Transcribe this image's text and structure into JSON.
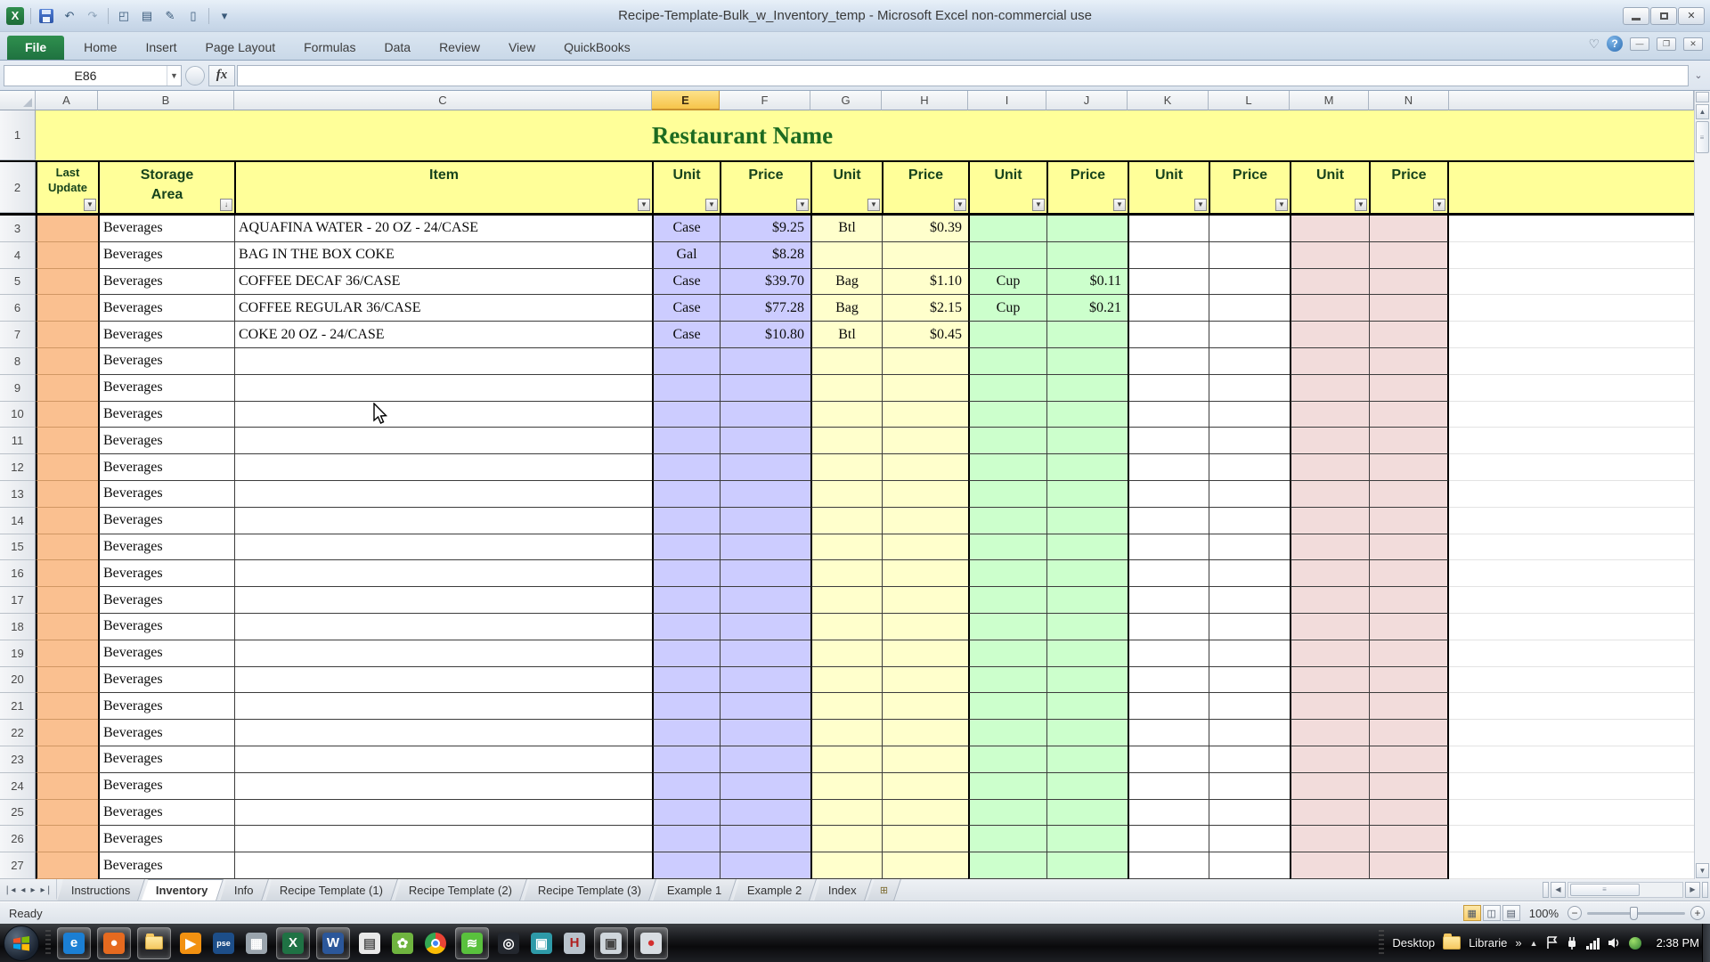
{
  "window": {
    "title": "Recipe-Template-Bulk_w_Inventory_temp  -  Microsoft Excel non-commercial use"
  },
  "qat": {
    "icons": [
      {
        "name": "excel-logo-icon",
        "glyph": "X"
      },
      {
        "name": "save-icon",
        "glyph": ""
      },
      {
        "name": "undo-icon",
        "glyph": "↶"
      },
      {
        "name": "redo-icon",
        "glyph": "↷"
      },
      {
        "name": "print-preview-icon",
        "glyph": "◰"
      },
      {
        "name": "print-icon",
        "glyph": "▤"
      },
      {
        "name": "edit-icon",
        "glyph": "✎"
      },
      {
        "name": "new-document-icon",
        "glyph": "▯"
      },
      {
        "name": "customize-quick-access-toolbar-icon",
        "glyph": "▾"
      }
    ]
  },
  "ribbon": {
    "tabs": [
      "File",
      "Home",
      "Insert",
      "Page Layout",
      "Formulas",
      "Data",
      "Review",
      "View",
      "QuickBooks"
    ],
    "active_tab": "File",
    "right_icons": [
      {
        "name": "favorite-icon",
        "glyph": "♡"
      },
      {
        "name": "help-icon",
        "glyph": "?"
      },
      {
        "name": "minimize-window-icon",
        "glyph": "—"
      },
      {
        "name": "restore-window-icon",
        "glyph": "❐"
      },
      {
        "name": "close-window-icon",
        "glyph": "✕"
      }
    ]
  },
  "formula_bar": {
    "name_box": "E86",
    "fx_label": "fx",
    "formula_value": ""
  },
  "grid": {
    "column_letters": [
      "A",
      "B",
      "C",
      "E",
      "F",
      "G",
      "H",
      "I",
      "J",
      "K",
      "L",
      "M",
      "N"
    ],
    "selected_column": "E",
    "row1_num": "1",
    "row2_num": "2",
    "title": "Restaurant Name",
    "header_cells": [
      {
        "col": "A",
        "lines": [
          "Last",
          "Update"
        ],
        "small": true,
        "filter": "▼"
      },
      {
        "col": "B",
        "lines": [
          "Storage",
          "Area"
        ],
        "filter": "↓"
      },
      {
        "col": "C",
        "lines": [
          "Item"
        ],
        "filter": "▼"
      },
      {
        "col": "E",
        "lines": [
          "Unit"
        ],
        "filter": "▼"
      },
      {
        "col": "F",
        "lines": [
          "Price"
        ],
        "filter": "▼"
      },
      {
        "col": "G",
        "lines": [
          "Unit"
        ],
        "filter": "▼"
      },
      {
        "col": "H",
        "lines": [
          "Price"
        ],
        "filter": "▼"
      },
      {
        "col": "I",
        "lines": [
          "Unit"
        ],
        "filter": "▼"
      },
      {
        "col": "J",
        "lines": [
          "Price"
        ],
        "filter": "▼"
      },
      {
        "col": "K",
        "lines": [
          "Unit"
        ],
        "filter": "▼"
      },
      {
        "col": "L",
        "lines": [
          "Price"
        ],
        "filter": "▼"
      },
      {
        "col": "M",
        "lines": [
          "Unit"
        ],
        "filter": "▼"
      },
      {
        "col": "N",
        "lines": [
          "Price"
        ],
        "filter": "▼"
      }
    ],
    "rows": [
      [
        "3",
        "Beverages",
        "AQUAFINA WATER - 20 OZ - 24/CASE",
        "Case",
        "$9.25",
        "Btl",
        "$0.39",
        "",
        "",
        "",
        "",
        "",
        ""
      ],
      [
        "4",
        "Beverages",
        "BAG IN THE BOX COKE",
        "Gal",
        "$8.28",
        "",
        "",
        "",
        "",
        "",
        "",
        "",
        ""
      ],
      [
        "5",
        "Beverages",
        "COFFEE DECAF 36/CASE",
        "Case",
        "$39.70",
        "Bag",
        "$1.10",
        "Cup",
        "$0.11",
        "",
        "",
        "",
        ""
      ],
      [
        "6",
        "Beverages",
        "COFFEE REGULAR 36/CASE",
        "Case",
        "$77.28",
        "Bag",
        "$2.15",
        "Cup",
        "$0.21",
        "",
        "",
        "",
        ""
      ],
      [
        "7",
        "Beverages",
        "COKE 20 OZ - 24/CASE",
        "Case",
        "$10.80",
        "Btl",
        "$0.45",
        "",
        "",
        "",
        "",
        "",
        ""
      ],
      [
        "8",
        "Beverages",
        "",
        "",
        "",
        "",
        "",
        "",
        "",
        "",
        "",
        "",
        ""
      ],
      [
        "9",
        "Beverages",
        "",
        "",
        "",
        "",
        "",
        "",
        "",
        "",
        "",
        "",
        ""
      ],
      [
        "10",
        "Beverages",
        "",
        "",
        "",
        "",
        "",
        "",
        "",
        "",
        "",
        "",
        ""
      ],
      [
        "11",
        "Beverages",
        "",
        "",
        "",
        "",
        "",
        "",
        "",
        "",
        "",
        "",
        ""
      ],
      [
        "12",
        "Beverages",
        "",
        "",
        "",
        "",
        "",
        "",
        "",
        "",
        "",
        "",
        ""
      ],
      [
        "13",
        "Beverages",
        "",
        "",
        "",
        "",
        "",
        "",
        "",
        "",
        "",
        "",
        ""
      ],
      [
        "14",
        "Beverages",
        "",
        "",
        "",
        "",
        "",
        "",
        "",
        "",
        "",
        "",
        ""
      ],
      [
        "15",
        "Beverages",
        "",
        "",
        "",
        "",
        "",
        "",
        "",
        "",
        "",
        "",
        ""
      ],
      [
        "16",
        "Beverages",
        "",
        "",
        "",
        "",
        "",
        "",
        "",
        "",
        "",
        "",
        ""
      ],
      [
        "17",
        "Beverages",
        "",
        "",
        "",
        "",
        "",
        "",
        "",
        "",
        "",
        "",
        ""
      ],
      [
        "18",
        "Beverages",
        "",
        "",
        "",
        "",
        "",
        "",
        "",
        "",
        "",
        "",
        ""
      ],
      [
        "19",
        "Beverages",
        "",
        "",
        "",
        "",
        "",
        "",
        "",
        "",
        "",
        "",
        ""
      ],
      [
        "20",
        "Beverages",
        "",
        "",
        "",
        "",
        "",
        "",
        "",
        "",
        "",
        "",
        ""
      ],
      [
        "21",
        "Beverages",
        "",
        "",
        "",
        "",
        "",
        "",
        "",
        "",
        "",
        "",
        ""
      ],
      [
        "22",
        "Beverages",
        "",
        "",
        "",
        "",
        "",
        "",
        "",
        "",
        "",
        "",
        ""
      ],
      [
        "23",
        "Beverages",
        "",
        "",
        "",
        "",
        "",
        "",
        "",
        "",
        "",
        "",
        ""
      ],
      [
        "24",
        "Beverages",
        "",
        "",
        "",
        "",
        "",
        "",
        "",
        "",
        "",
        "",
        ""
      ],
      [
        "25",
        "Beverages",
        "",
        "",
        "",
        "",
        "",
        "",
        "",
        "",
        "",
        "",
        ""
      ],
      [
        "26",
        "Beverages",
        "",
        "",
        "",
        "",
        "",
        "",
        "",
        "",
        "",
        "",
        ""
      ],
      [
        "27",
        "Beverages",
        "",
        "",
        "",
        "",
        "",
        "",
        "",
        "",
        "",
        "",
        ""
      ]
    ]
  },
  "sheet_tabs": {
    "tabs": [
      "Instructions",
      "Inventory",
      "Info",
      "Recipe Template (1)",
      "Recipe Template (2)",
      "Recipe Template (3)",
      "Example 1",
      "Example 2",
      "Index"
    ],
    "active_tab": "Inventory"
  },
  "status_bar": {
    "mode": "Ready",
    "zoom_level": "100%",
    "view_icons": [
      {
        "name": "normal-view-icon",
        "glyph": "▦",
        "active": true
      },
      {
        "name": "page-layout-view-icon",
        "glyph": "◫",
        "active": false
      },
      {
        "name": "page-break-view-icon",
        "glyph": "▤",
        "active": false
      }
    ]
  },
  "taskbar": {
    "icons": [
      {
        "name": "internet-explorer-icon",
        "glyph": "e",
        "bg": "#1b7fd4",
        "boxed": true
      },
      {
        "name": "firefox-icon",
        "glyph": "●",
        "bg": "#e66a1f",
        "boxed": true
      },
      {
        "name": "windows-explorer-icon",
        "glyph": "",
        "bg": "",
        "boxed": true,
        "folder": true
      },
      {
        "name": "media-player-icon",
        "glyph": "▶",
        "bg": "#f29111",
        "boxed": false
      },
      {
        "name": "photoshop-elements-icon",
        "glyph": "pse",
        "bg": "#1d4e89",
        "boxed": false
      },
      {
        "name": "calculator-icon",
        "glyph": "▦",
        "bg": "#9aa4ad",
        "boxed": false
      },
      {
        "name": "excel-icon",
        "glyph": "X",
        "bg": "#1f7244",
        "boxed": true
      },
      {
        "name": "word-icon",
        "glyph": "W",
        "bg": "#2b579a",
        "boxed": true
      },
      {
        "name": "notepad-icon",
        "glyph": "▤",
        "bg": "#e8e8e8",
        "fg": "#555",
        "boxed": false
      },
      {
        "name": "green-app-icon",
        "glyph": "✿",
        "bg": "#6fb43f",
        "boxed": false
      },
      {
        "name": "chrome-icon",
        "glyph": "◉",
        "bg": "",
        "boxed": false,
        "chrome": true
      },
      {
        "name": "spotify-icon",
        "glyph": "≋",
        "bg": "#59c13d",
        "boxed": true
      },
      {
        "name": "dark-app-icon",
        "glyph": "◎",
        "bg": "#23272e",
        "boxed": false
      },
      {
        "name": "teal-app-icon",
        "glyph": "▣",
        "bg": "#2e9aa8",
        "boxed": false
      },
      {
        "name": "hypercam-icon",
        "glyph": "H",
        "bg": "#b9c3cc",
        "fg": "#b02020",
        "boxed": false
      },
      {
        "name": "screen-capture-icon",
        "glyph": "▣",
        "bg": "#cfd6dc",
        "fg": "#444",
        "boxed": true
      },
      {
        "name": "screen-recorder-icon",
        "glyph": "●",
        "bg": "#d8dde2",
        "fg": "#d32f2f",
        "boxed": true
      }
    ],
    "tray": {
      "desktop_label": "Desktop",
      "libraries_label": "Librarie",
      "overflow_chevron": "»",
      "hidden_icons_arrow": "▲",
      "clock": "2:38 PM"
    }
  }
}
